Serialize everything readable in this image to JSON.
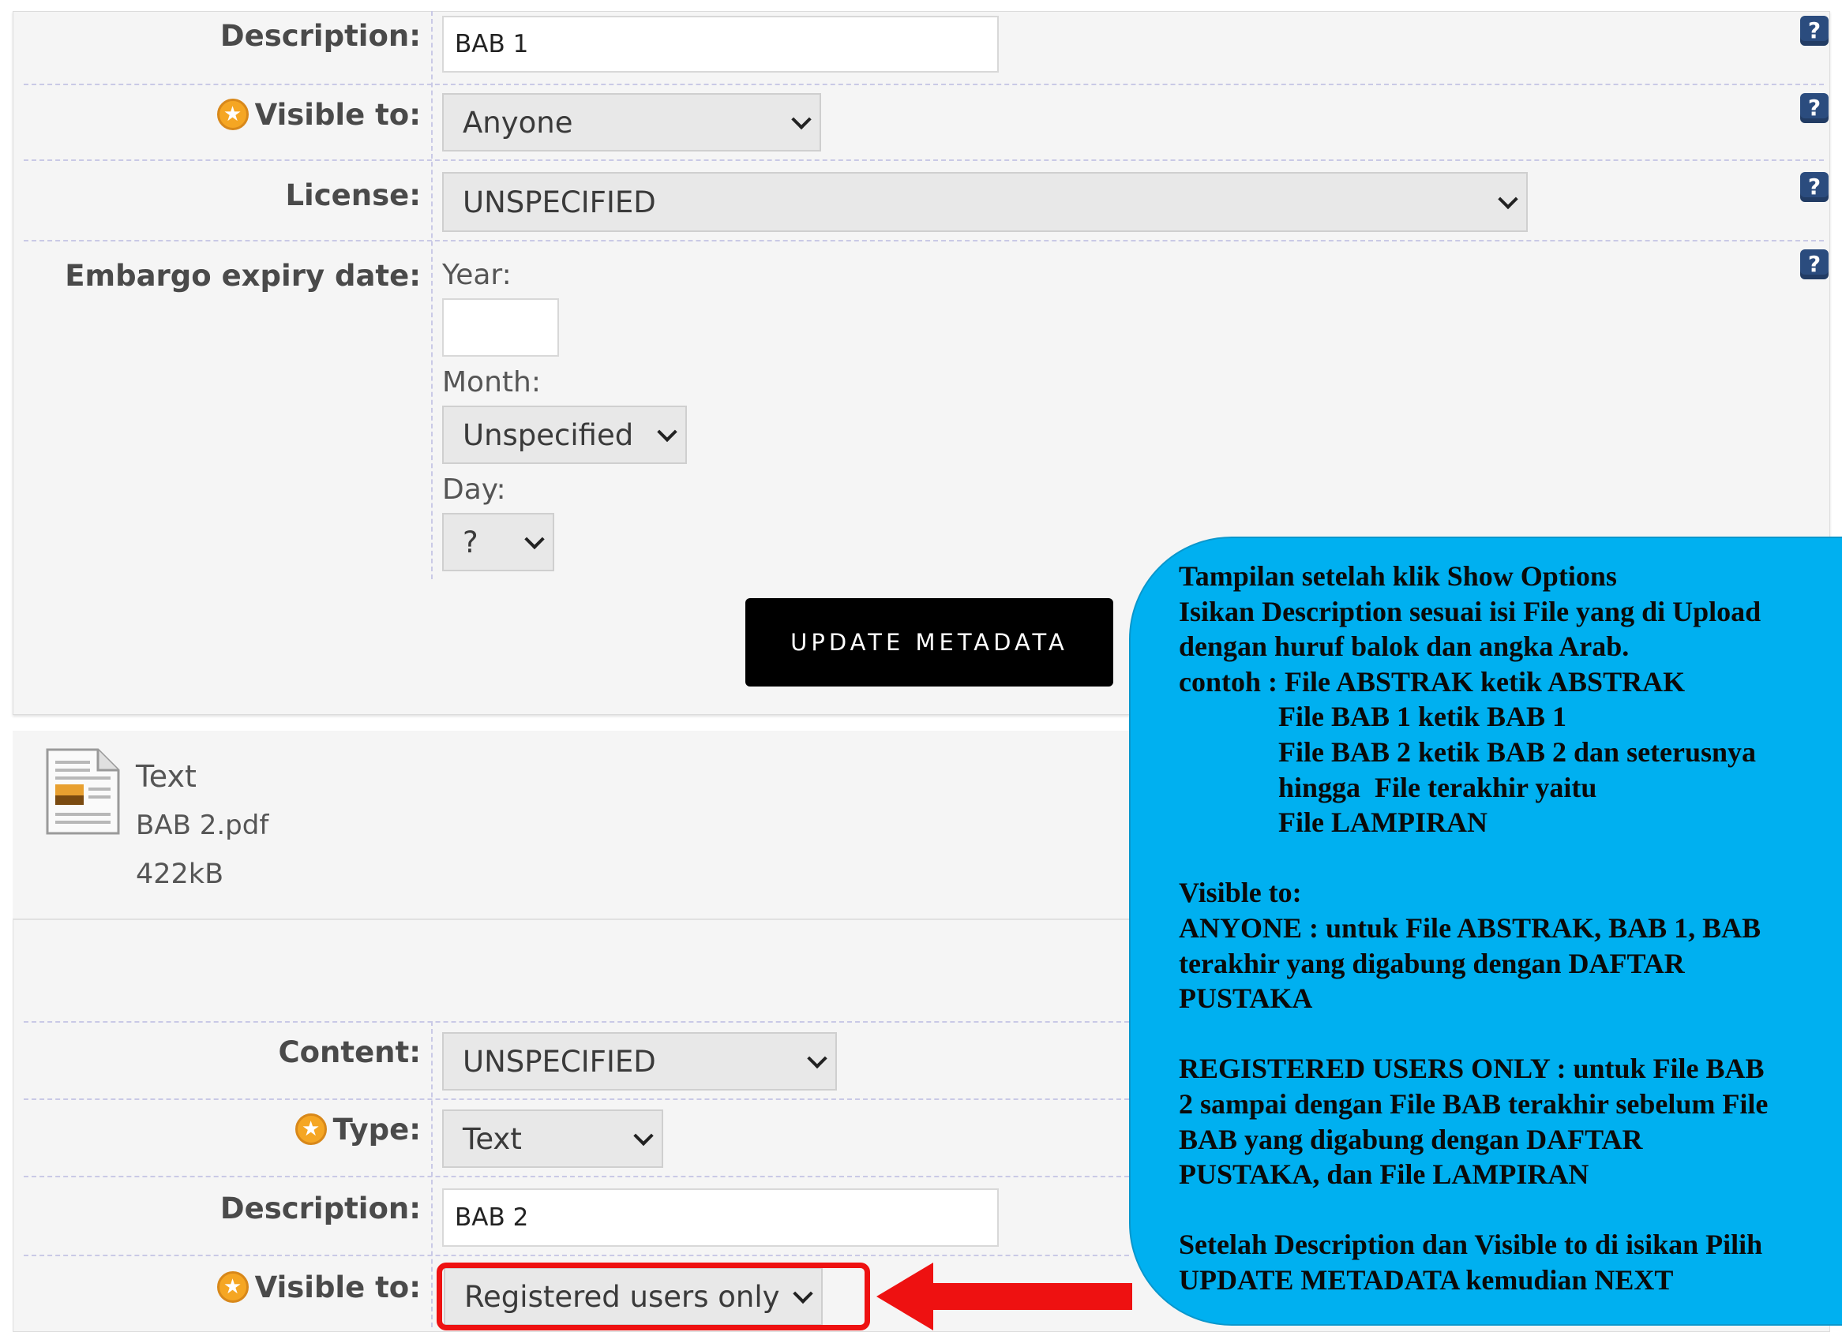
{
  "panel1": {
    "description_label": "Description:",
    "description_value": "BAB 1",
    "visible_label": "Visible to:",
    "visible_value": "Anyone",
    "license_label": "License:",
    "license_value": "UNSPECIFIED",
    "embargo_label": "Embargo expiry date:",
    "year_label": "Year:",
    "year_value": "",
    "month_label": "Month:",
    "month_value": "Unspecified",
    "day_label": "Day:",
    "day_value": "?",
    "update_button": "UPDATE METADATA"
  },
  "file2": {
    "type_text": "Text",
    "filename": "BAB 2.pdf",
    "size": "422kB",
    "content_label": "Content:",
    "content_value": "UNSPECIFIED",
    "type_label": "Type:",
    "type_value": "Text",
    "description_label": "Description:",
    "description_value": "BAB 2",
    "visible_label": "Visible to:",
    "visible_value": "Registered users only"
  },
  "help_icon": "?",
  "annotation": {
    "text": "Tampilan setelah klik Show Options\nIsikan Description sesuai isi File yang di Upload\ndengan huruf balok dan angka Arab.\ncontoh : File ABSTRAK ketik ABSTRAK\n              File BAB 1 ketik BAB 1\n              File BAB 2 ketik BAB 2 dan seterusnya\n              hingga  File terakhir yaitu\n              File LAMPIRAN\n\nVisible to:\nANYONE : untuk File ABSTRAK, BAB 1, BAB\nterakhir yang digabung dengan DAFTAR\nPUSTAKA\n\nREGISTERED USERS ONLY : untuk File BAB\n2 sampai dengan File BAB terakhir sebelum File\nBAB yang digabung dengan DAFTAR\nPUSTAKA, dan File LAMPIRAN\n\nSetelah Description dan Visible to di isikan Pilih\nUPDATE METADATA kemudian NEXT"
  },
  "colors": {
    "bubble": "#00b0f0",
    "highlight": "#ee1111",
    "button": "#000000"
  },
  "icons": [
    "help-icon",
    "star-icon",
    "chevron-down-icon",
    "file-document-icon",
    "arrow-left-icon"
  ]
}
